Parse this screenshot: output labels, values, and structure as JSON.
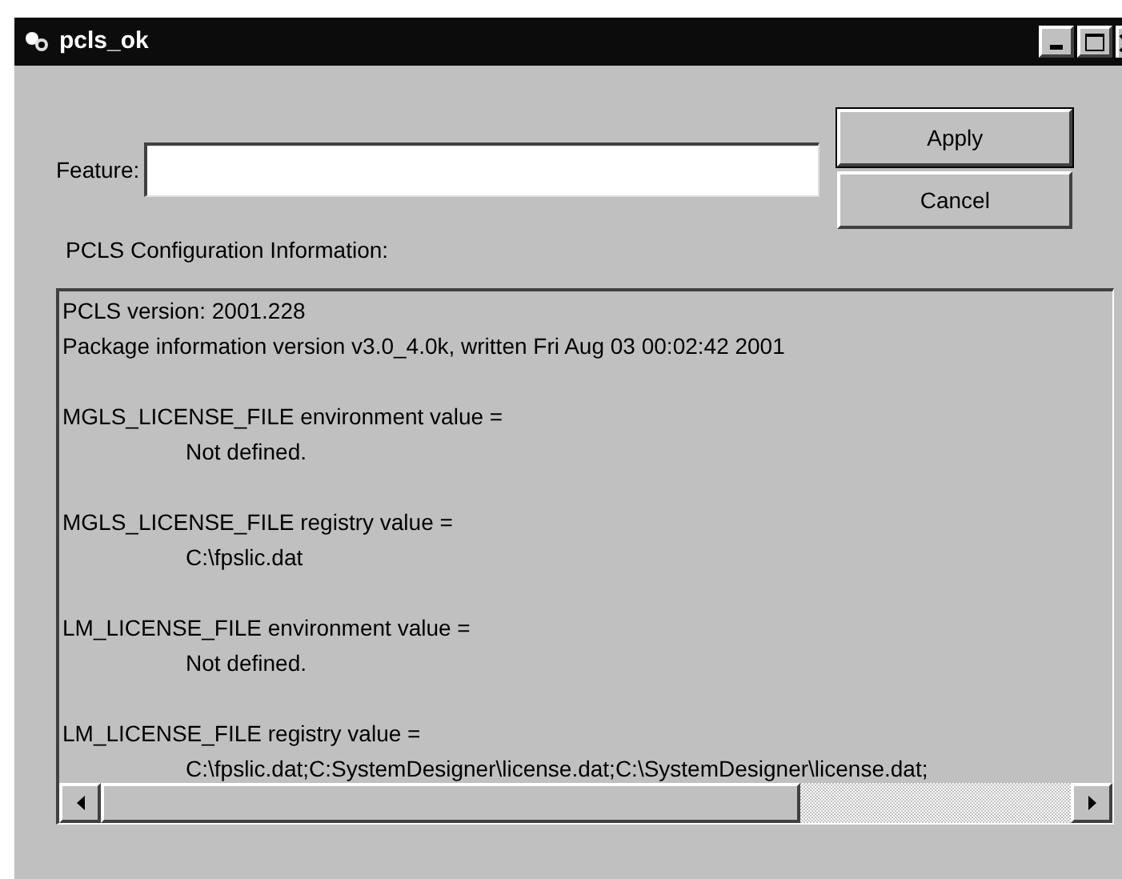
{
  "window": {
    "title": "pcls_ok"
  },
  "feature": {
    "label": "Feature:"
  },
  "buttons": [
    "Apply",
    "Cancel"
  ],
  "info": {
    "label": "PCLS Configuration Information:",
    "lines": [
      {
        "kind": "text",
        "text": "PCLS version: 2001.228"
      },
      {
        "kind": "text",
        "text": "Package information version v3.0_4.0k, written Fri Aug 03 00:02:42 2001"
      },
      {
        "kind": "blank"
      },
      {
        "kind": "text",
        "text": "MGLS_LICENSE_FILE environment value ="
      },
      {
        "kind": "indent",
        "text": "Not defined."
      },
      {
        "kind": "blank"
      },
      {
        "kind": "text",
        "text": "MGLS_LICENSE_FILE registry value ="
      },
      {
        "kind": "indent",
        "text": "C:\\fpslic.dat"
      },
      {
        "kind": "blank"
      },
      {
        "kind": "text",
        "text": "LM_LICENSE_FILE environment value ="
      },
      {
        "kind": "indent",
        "text": "Not defined."
      },
      {
        "kind": "blank"
      },
      {
        "kind": "text",
        "text": "LM_LICENSE_FILE registry value ="
      },
      {
        "kind": "indent",
        "text": "C:\\fpslic.dat;C:SystemDesigner\\license.dat;C:\\SystemDesigner\\license.dat;"
      }
    ]
  }
}
